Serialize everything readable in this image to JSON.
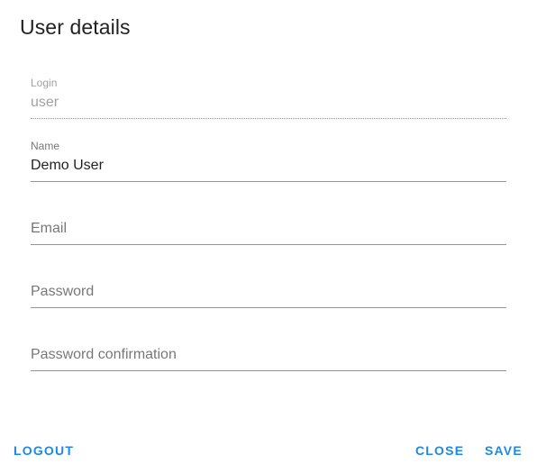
{
  "dialog": {
    "title": "User details"
  },
  "fields": {
    "login": {
      "label": "Login",
      "value": "user",
      "disabled": true
    },
    "name": {
      "label": "Name",
      "value": "Demo User"
    },
    "email": {
      "label": "Email",
      "value": ""
    },
    "password": {
      "label": "Password",
      "value": ""
    },
    "password_confirmation": {
      "label": "Password confirmation",
      "value": ""
    }
  },
  "actions": {
    "logout_label": "LOGOUT",
    "close_label": "CLOSE",
    "save_label": "SAVE"
  },
  "colors": {
    "accent": "#1e88e5",
    "text_primary": "#212121",
    "text_secondary": "#757575"
  }
}
